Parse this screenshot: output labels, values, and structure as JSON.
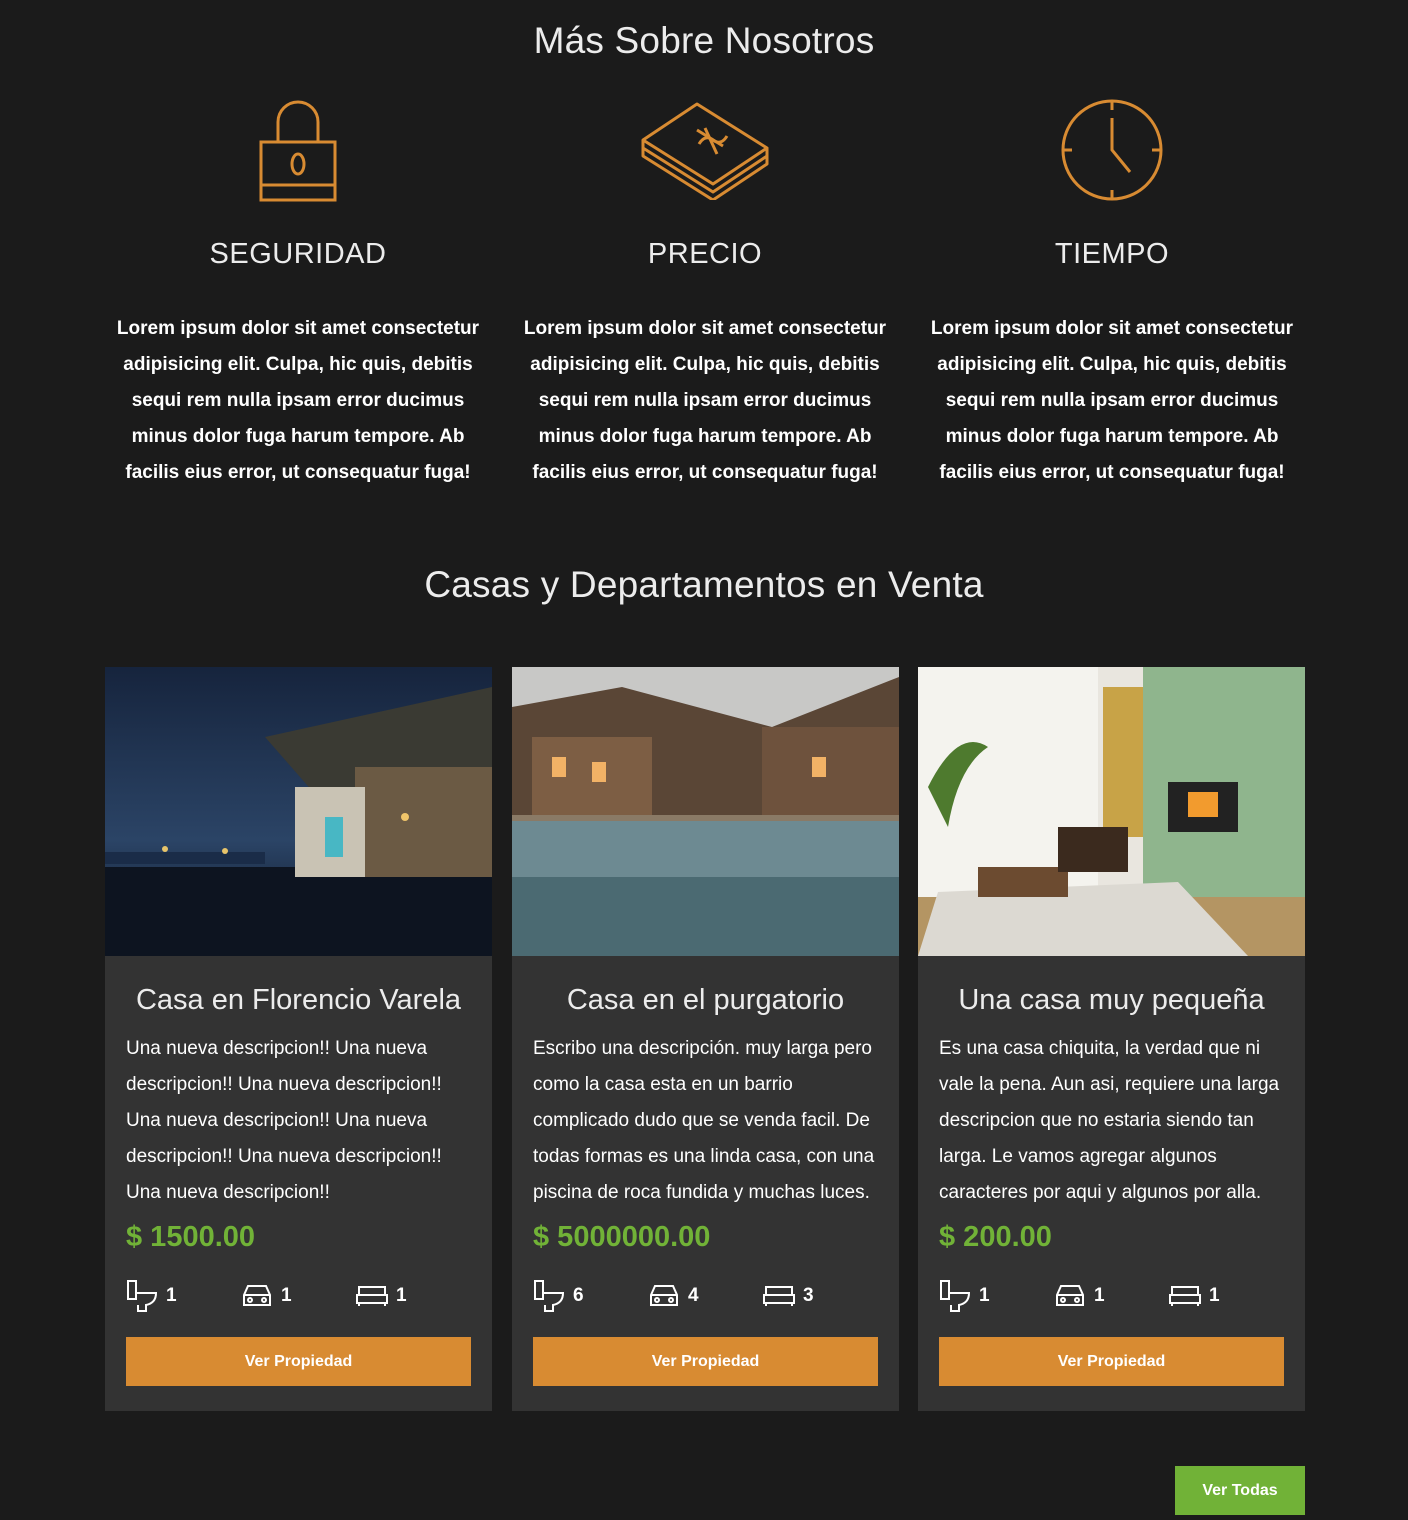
{
  "about": {
    "title": "Más Sobre Nosotros",
    "items": [
      {
        "icon": "lock-icon",
        "title": "SEGURIDAD",
        "text": "Lorem ipsum dolor sit amet consectetur adipisicing elit. Culpa, hic quis, debitis sequi rem nulla ipsam error ducimus minus dolor fuga harum tempore. Ab facilis eius error, ut consequatur fuga!"
      },
      {
        "icon": "money-icon",
        "title": "PRECIO",
        "text": "Lorem ipsum dolor sit amet consectetur adipisicing elit. Culpa, hic quis, debitis sequi rem nulla ipsam error ducimus minus dolor fuga harum tempore. Ab facilis eius error, ut consequatur fuga!"
      },
      {
        "icon": "clock-icon",
        "title": "TIEMPO",
        "text": "Lorem ipsum dolor sit amet consectetur adipisicing elit. Culpa, hic quis, debitis sequi rem nulla ipsam error ducimus minus dolor fuga harum tempore. Ab facilis eius error, ut consequatur fuga!"
      }
    ]
  },
  "listings": {
    "title": "Casas y Departamentos en Venta",
    "cards": [
      {
        "title": "Casa en Florencio Varela",
        "description": "Una nueva descripcion!! Una nueva descripcion!! Una nueva descripcion!! Una nueva descripcion!! Una nueva descripcion!! Una nueva descripcion!! Una nueva descripcion!!",
        "price": "$ 1500.00",
        "baths": "1",
        "parking": "1",
        "rooms": "1",
        "button": "Ver Propiedad",
        "image": "night-house-photo"
      },
      {
        "title": "Casa en el purgatorio",
        "description": "Escribo una descripción. muy larga pero como la casa esta en un barrio complicado dudo que se venda facil. De todas formas es una linda casa, con una piscina de roca fundida y muchas luces.",
        "price": "$ 5000000.00",
        "baths": "6",
        "parking": "4",
        "rooms": "3",
        "button": "Ver Propiedad",
        "image": "pool-lodge-photo"
      },
      {
        "title": "Una casa muy pequeña",
        "description": "Es una casa chiquita, la verdad que ni vale la pena. Aun asi, requiere una larga descripcion que no estaria siendo tan larga. Le vamos agregar algunos caracteres por aqui y algunos por alla.",
        "price": "$ 200.00",
        "baths": "1",
        "parking": "1",
        "rooms": "1",
        "button": "Ver Propiedad",
        "image": "living-room-photo"
      }
    ],
    "view_all": "Ver Todas"
  },
  "colors": {
    "accent": "#d88b32",
    "price": "#71b237",
    "background": "#1b1b1b",
    "card": "#333333"
  }
}
